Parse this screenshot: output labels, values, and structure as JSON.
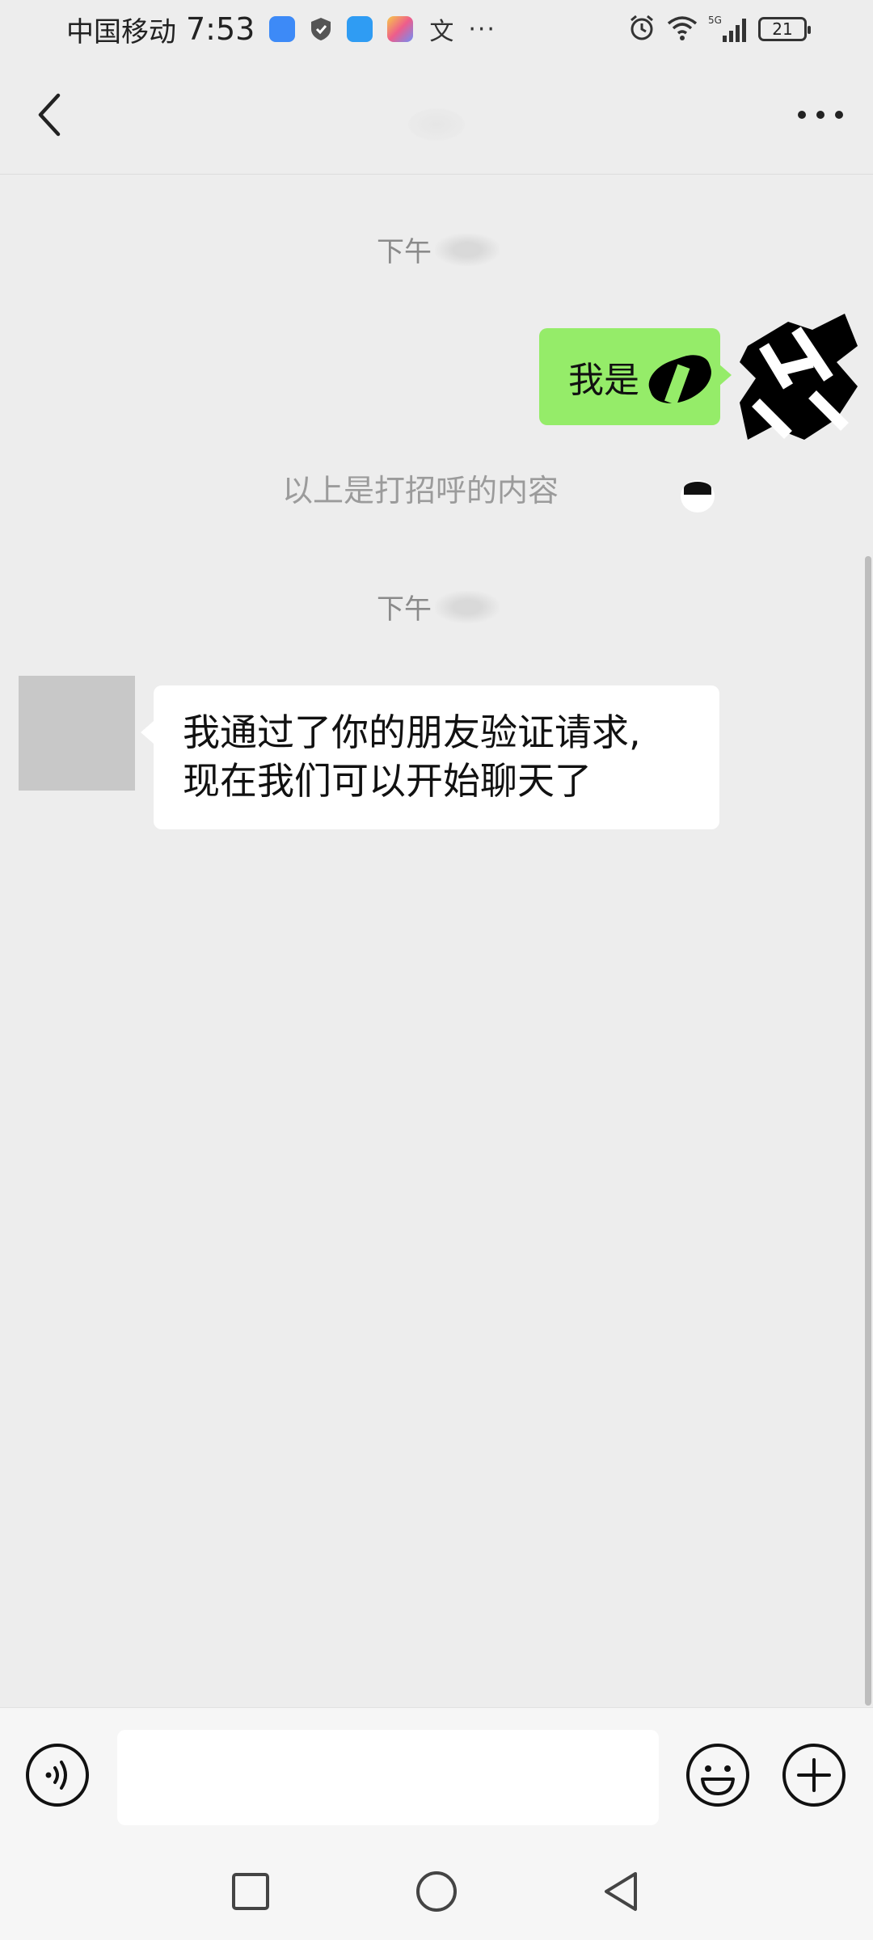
{
  "status_bar": {
    "carrier": "中国移动",
    "time": "7:53",
    "translate_glyph": "文",
    "more_notifications": "···",
    "battery_level": "21",
    "network_label": "5G",
    "icons": [
      "cloud-icon",
      "shield-icon",
      "weather-icon",
      "flag-app-icon",
      "translate-icon",
      "alarm-icon",
      "wifi-icon",
      "signal-icon",
      "battery-icon"
    ]
  },
  "header": {
    "back_icon": "chevron-left-icon",
    "more_icon": "more-horizontal-icon"
  },
  "chat": {
    "timestamp_1": "下午",
    "outgoing_message": "我是",
    "system_note": "以上是打招呼的内容",
    "timestamp_2": "下午",
    "incoming_message_line1": "我通过了你的朋友验证请求,",
    "incoming_message_line2": "现在我们可以开始聊天了"
  },
  "input_bar": {
    "placeholder": "",
    "icons": [
      "voice-icon",
      "emoji-icon",
      "plus-icon"
    ]
  },
  "nav_bar": {
    "icons": [
      "recent-apps-icon",
      "home-icon",
      "back-icon"
    ]
  },
  "colors": {
    "background": "#ededed",
    "outgoing_bubble": "#95ec69",
    "incoming_bubble": "#ffffff",
    "timestamp_text": "#8a8a8a"
  }
}
